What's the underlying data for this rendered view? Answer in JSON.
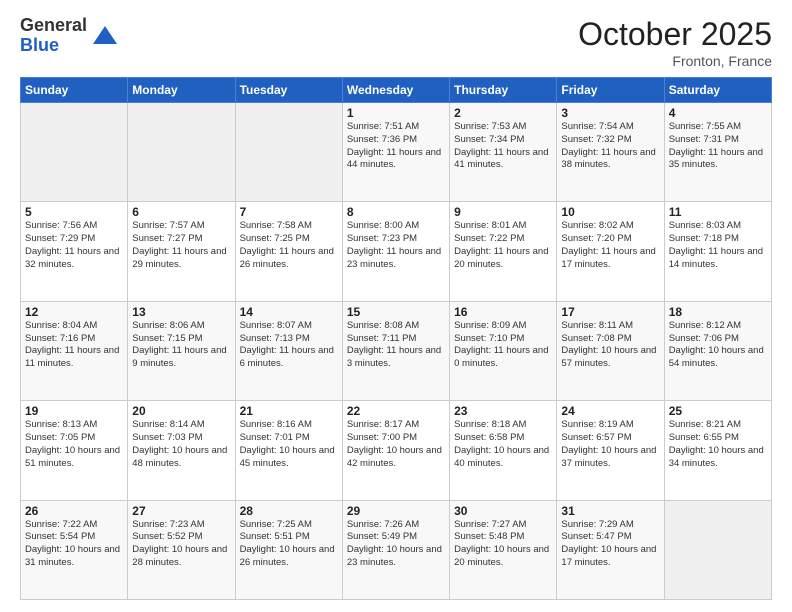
{
  "header": {
    "month_title": "October 2025",
    "location": "Fronton, France",
    "logo_general": "General",
    "logo_blue": "Blue"
  },
  "columns": [
    "Sunday",
    "Monday",
    "Tuesday",
    "Wednesday",
    "Thursday",
    "Friday",
    "Saturday"
  ],
  "weeks": [
    [
      {
        "day": "",
        "info": ""
      },
      {
        "day": "",
        "info": ""
      },
      {
        "day": "",
        "info": ""
      },
      {
        "day": "1",
        "info": "Sunrise: 7:51 AM\nSunset: 7:36 PM\nDaylight: 11 hours\nand 44 minutes."
      },
      {
        "day": "2",
        "info": "Sunrise: 7:53 AM\nSunset: 7:34 PM\nDaylight: 11 hours\nand 41 minutes."
      },
      {
        "day": "3",
        "info": "Sunrise: 7:54 AM\nSunset: 7:32 PM\nDaylight: 11 hours\nand 38 minutes."
      },
      {
        "day": "4",
        "info": "Sunrise: 7:55 AM\nSunset: 7:31 PM\nDaylight: 11 hours\nand 35 minutes."
      }
    ],
    [
      {
        "day": "5",
        "info": "Sunrise: 7:56 AM\nSunset: 7:29 PM\nDaylight: 11 hours\nand 32 minutes."
      },
      {
        "day": "6",
        "info": "Sunrise: 7:57 AM\nSunset: 7:27 PM\nDaylight: 11 hours\nand 29 minutes."
      },
      {
        "day": "7",
        "info": "Sunrise: 7:58 AM\nSunset: 7:25 PM\nDaylight: 11 hours\nand 26 minutes."
      },
      {
        "day": "8",
        "info": "Sunrise: 8:00 AM\nSunset: 7:23 PM\nDaylight: 11 hours\nand 23 minutes."
      },
      {
        "day": "9",
        "info": "Sunrise: 8:01 AM\nSunset: 7:22 PM\nDaylight: 11 hours\nand 20 minutes."
      },
      {
        "day": "10",
        "info": "Sunrise: 8:02 AM\nSunset: 7:20 PM\nDaylight: 11 hours\nand 17 minutes."
      },
      {
        "day": "11",
        "info": "Sunrise: 8:03 AM\nSunset: 7:18 PM\nDaylight: 11 hours\nand 14 minutes."
      }
    ],
    [
      {
        "day": "12",
        "info": "Sunrise: 8:04 AM\nSunset: 7:16 PM\nDaylight: 11 hours\nand 11 minutes."
      },
      {
        "day": "13",
        "info": "Sunrise: 8:06 AM\nSunset: 7:15 PM\nDaylight: 11 hours\nand 9 minutes."
      },
      {
        "day": "14",
        "info": "Sunrise: 8:07 AM\nSunset: 7:13 PM\nDaylight: 11 hours\nand 6 minutes."
      },
      {
        "day": "15",
        "info": "Sunrise: 8:08 AM\nSunset: 7:11 PM\nDaylight: 11 hours\nand 3 minutes."
      },
      {
        "day": "16",
        "info": "Sunrise: 8:09 AM\nSunset: 7:10 PM\nDaylight: 11 hours\nand 0 minutes."
      },
      {
        "day": "17",
        "info": "Sunrise: 8:11 AM\nSunset: 7:08 PM\nDaylight: 10 hours\nand 57 minutes."
      },
      {
        "day": "18",
        "info": "Sunrise: 8:12 AM\nSunset: 7:06 PM\nDaylight: 10 hours\nand 54 minutes."
      }
    ],
    [
      {
        "day": "19",
        "info": "Sunrise: 8:13 AM\nSunset: 7:05 PM\nDaylight: 10 hours\nand 51 minutes."
      },
      {
        "day": "20",
        "info": "Sunrise: 8:14 AM\nSunset: 7:03 PM\nDaylight: 10 hours\nand 48 minutes."
      },
      {
        "day": "21",
        "info": "Sunrise: 8:16 AM\nSunset: 7:01 PM\nDaylight: 10 hours\nand 45 minutes."
      },
      {
        "day": "22",
        "info": "Sunrise: 8:17 AM\nSunset: 7:00 PM\nDaylight: 10 hours\nand 42 minutes."
      },
      {
        "day": "23",
        "info": "Sunrise: 8:18 AM\nSunset: 6:58 PM\nDaylight: 10 hours\nand 40 minutes."
      },
      {
        "day": "24",
        "info": "Sunrise: 8:19 AM\nSunset: 6:57 PM\nDaylight: 10 hours\nand 37 minutes."
      },
      {
        "day": "25",
        "info": "Sunrise: 8:21 AM\nSunset: 6:55 PM\nDaylight: 10 hours\nand 34 minutes."
      }
    ],
    [
      {
        "day": "26",
        "info": "Sunrise: 7:22 AM\nSunset: 5:54 PM\nDaylight: 10 hours\nand 31 minutes."
      },
      {
        "day": "27",
        "info": "Sunrise: 7:23 AM\nSunset: 5:52 PM\nDaylight: 10 hours\nand 28 minutes."
      },
      {
        "day": "28",
        "info": "Sunrise: 7:25 AM\nSunset: 5:51 PM\nDaylight: 10 hours\nand 26 minutes."
      },
      {
        "day": "29",
        "info": "Sunrise: 7:26 AM\nSunset: 5:49 PM\nDaylight: 10 hours\nand 23 minutes."
      },
      {
        "day": "30",
        "info": "Sunrise: 7:27 AM\nSunset: 5:48 PM\nDaylight: 10 hours\nand 20 minutes."
      },
      {
        "day": "31",
        "info": "Sunrise: 7:29 AM\nSunset: 5:47 PM\nDaylight: 10 hours\nand 17 minutes."
      },
      {
        "day": "",
        "info": ""
      }
    ]
  ]
}
